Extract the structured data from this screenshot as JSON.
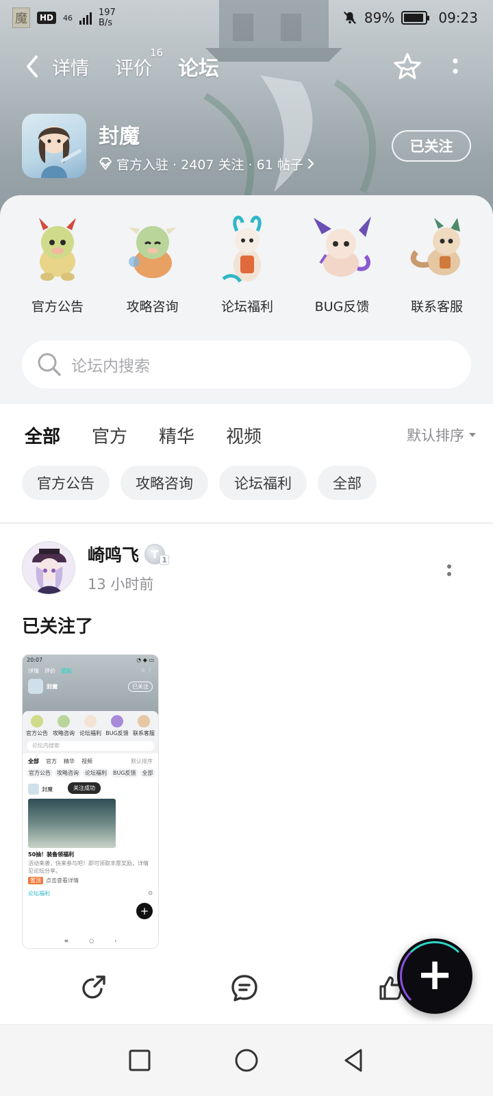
{
  "status_bar": {
    "seal_char": "魔",
    "hd": "HD",
    "network": "46",
    "speed_value": "197",
    "speed_unit": "B/s",
    "battery": "89%",
    "time": "09:23"
  },
  "nav": {
    "tabs": [
      {
        "label": "详情"
      },
      {
        "label": "评价",
        "badge": "16"
      },
      {
        "label": "论坛"
      }
    ],
    "accent": "#2fd7c6"
  },
  "game": {
    "name": "封魔",
    "meta": "官方入驻 · 2407 关注 · 61 帖子",
    "follow_label": "已关注"
  },
  "categories": [
    {
      "label": "官方公告"
    },
    {
      "label": "攻略咨询"
    },
    {
      "label": "论坛福利"
    },
    {
      "label": "BUG反馈"
    },
    {
      "label": "联系客服"
    }
  ],
  "search": {
    "placeholder": "论坛内搜索"
  },
  "filter_tabs": [
    "全部",
    "官方",
    "精华",
    "视频"
  ],
  "sort_label": "默认排序",
  "chips": [
    "官方公告",
    "攻略咨询",
    "论坛福利",
    "全部"
  ],
  "post": {
    "author": "崎鸣飞",
    "level_letter": "T",
    "level_num": "1",
    "time": "13 小时前",
    "text": "已关注了"
  },
  "thumb": {
    "time": "20:07",
    "nav": [
      "详情",
      "评价",
      "论坛"
    ],
    "game_name": "封魔",
    "follow": "已关注",
    "cats": [
      "官方公告",
      "攻略咨询",
      "论坛福利",
      "BUG反馈",
      "联系客服"
    ],
    "search": "论坛内搜索",
    "tabs": [
      "全部",
      "官方",
      "精华",
      "视频"
    ],
    "sort": "默认排序",
    "chips": [
      "官方公告",
      "攻略咨询",
      "论坛福利",
      "BUG反馈",
      "全部"
    ],
    "post_author": "封魔",
    "toast": "关注成功",
    "post_title": "50抽！装备领福利",
    "post_desc": "活动来袭，快来参与吧！即可领取丰厚奖励，详情见论坛分享。",
    "tag": "置顶",
    "tag2": "点击查看详情",
    "foot_left": "论坛福利"
  }
}
